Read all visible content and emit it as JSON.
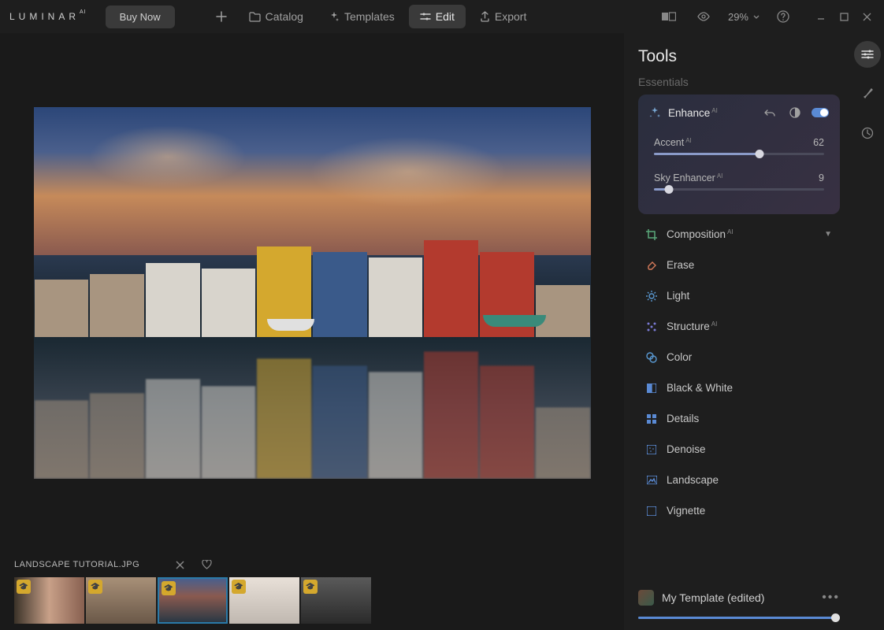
{
  "header": {
    "logo": "LUMINAR",
    "logo_sup": "AI",
    "buy_now": "Buy Now",
    "nav": {
      "catalog": "Catalog",
      "templates": "Templates",
      "edit": "Edit",
      "export": "Export"
    },
    "zoom": "29%"
  },
  "filmstrip": {
    "filename": "LANDSCAPE TUTORIAL.JPG"
  },
  "tools": {
    "title": "Tools",
    "section_essentials": "Essentials",
    "enhance": {
      "label": "Enhance",
      "accent_label": "Accent",
      "accent_value": "62",
      "sky_label": "Sky Enhancer",
      "sky_value": "9"
    },
    "items": {
      "composition": "Composition",
      "erase": "Erase",
      "light": "Light",
      "structure": "Structure",
      "color": "Color",
      "bw": "Black & White",
      "details": "Details",
      "denoise": "Denoise",
      "landscape": "Landscape",
      "vignette": "Vignette"
    },
    "template": "My Template (edited)"
  }
}
